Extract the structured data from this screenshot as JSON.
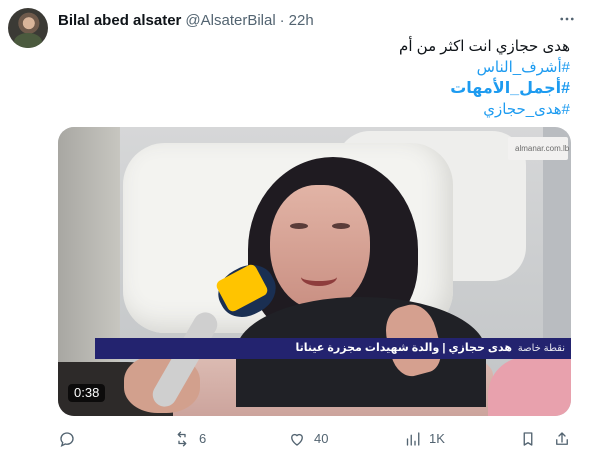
{
  "author": {
    "display_name": "Bilal abed alsater",
    "handle": "@AlsaterBilal",
    "separator": "·",
    "time": "22h"
  },
  "menu": {
    "icon": "more-dots-icon"
  },
  "text": {
    "line1": "هدى حجازي انت اكثر من أم",
    "line2": "#أشرف_الناس",
    "line3": "#أجمل_الأمهات",
    "line4": "#هدى_حجازي"
  },
  "media": {
    "channel_logo": "almanar.com.lb",
    "lower_third_main": "هدى حجازي | والدة شهيدات مجزرة عيناتا",
    "lower_third_sub": "نقطة خاصة",
    "duration": "0:38"
  },
  "actions": {
    "reply": {
      "icon": "reply-icon",
      "count": ""
    },
    "retweet": {
      "icon": "retweet-icon",
      "count": "6"
    },
    "like": {
      "icon": "heart-icon",
      "count": "40"
    },
    "views": {
      "icon": "views-icon",
      "count": "1K"
    },
    "bookmark": {
      "icon": "bookmark-icon",
      "count": ""
    },
    "share": {
      "icon": "share-icon",
      "count": ""
    }
  },
  "colors": {
    "text_primary": "#0f1419",
    "text_secondary": "#536471",
    "hashtag": "#1d9bf0",
    "lower_third": "#23236f"
  }
}
